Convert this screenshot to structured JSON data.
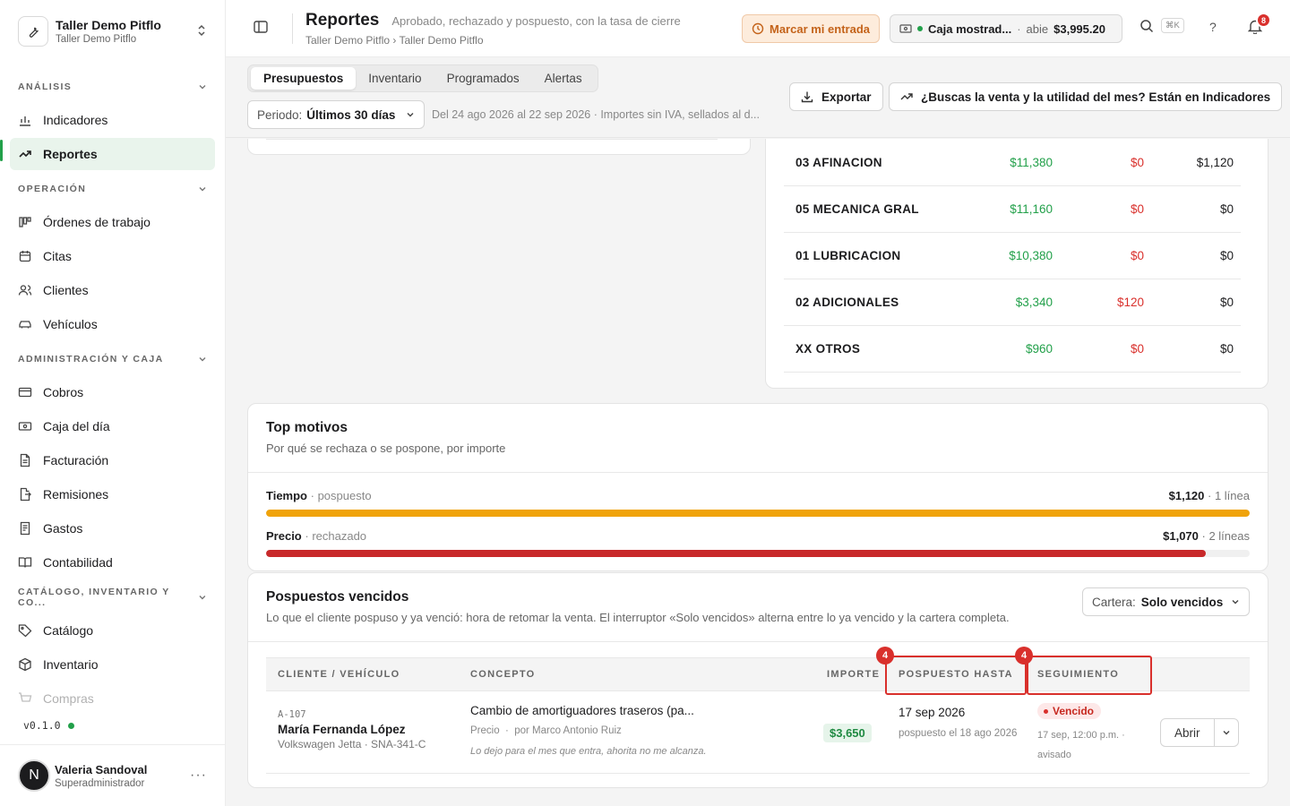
{
  "workspace": {
    "name": "Taller Demo Pitflo",
    "sub": "Taller Demo Pitflo"
  },
  "sidebar": {
    "sections": [
      {
        "label": "ANÁLISIS",
        "items": [
          "Indicadores",
          "Reportes"
        ]
      },
      {
        "label": "OPERACIÓN",
        "items": [
          "Órdenes de trabajo",
          "Citas",
          "Clientes",
          "Vehículos"
        ]
      },
      {
        "label": "ADMINISTRACIÓN Y CAJA",
        "items": [
          "Cobros",
          "Caja del día",
          "Facturación",
          "Remisiones",
          "Gastos",
          "Contabilidad"
        ]
      },
      {
        "label": "CATÁLOGO, INVENTARIO Y CO...",
        "items": [
          "Catálogo",
          "Inventario",
          "Compras"
        ]
      }
    ],
    "active_item": "Reportes",
    "version": "v0.1.0",
    "user": {
      "initial": "N",
      "name": "Valeria Sandoval",
      "role": "Superadministrador"
    }
  },
  "topbar": {
    "title": "Reportes",
    "description": "Aprobado, rechazado y pospuesto, con la tasa de cierre",
    "breadcrumb": "Taller Demo Pitflo › Taller Demo Pitflo",
    "entry_button": "Marcar mi entrada",
    "caja": {
      "name": "Caja mostrad...",
      "sep": "·",
      "status": "abie",
      "amount": "$3,995.20"
    },
    "search_shortcut": "⌘K",
    "help": "?",
    "notifications": "8"
  },
  "subbar": {
    "tabs": [
      "Presupuestos",
      "Inventario",
      "Programados",
      "Alertas"
    ],
    "active_tab": "Presupuestos",
    "period_label": "Periodo:",
    "period_value": "Últimos 30 días",
    "range_text": "Del 24 ago 2026 al 22 sep 2026 · Importes sin IVA, sellados al d...",
    "export_button": "Exportar",
    "indicators_button": "¿Buscas la venta y la utilidad del mes? Están en Indicadores"
  },
  "category_table": {
    "rows": [
      {
        "name": "03 AFINACION",
        "approved": "$11,380",
        "rejected": "$0",
        "postponed": "$1,120"
      },
      {
        "name": "05 MECANICA GRAL",
        "approved": "$11,160",
        "rejected": "$0",
        "postponed": "$0"
      },
      {
        "name": "01 LUBRICACION",
        "approved": "$10,380",
        "rejected": "$0",
        "postponed": "$0"
      },
      {
        "name": "02 ADICIONALES",
        "approved": "$3,340",
        "rejected": "$120",
        "postponed": "$0"
      },
      {
        "name": "XX OTROS",
        "approved": "$960",
        "rejected": "$0",
        "postponed": "$0"
      }
    ]
  },
  "top_motivos": {
    "title": "Top motivos",
    "subtitle": "Por qué se rechaza o se pospone, por importe",
    "items": [
      {
        "reason": "Tiempo",
        "type": "· pospuesto",
        "amount": "$1,120",
        "count": "· 1 línea",
        "fraction": 1.0,
        "color": "#f0a30a"
      },
      {
        "reason": "Precio",
        "type": "· rechazado",
        "amount": "$1,070",
        "count": "· 2 líneas",
        "fraction": 0.955,
        "color": "#c8292a"
      }
    ]
  },
  "pospuestos": {
    "title": "Pospuestos vencidos",
    "subtitle": "Lo que el cliente pospuso y ya venció: hora de retomar la venta. El interruptor «Solo vencidos» alterna entre lo ya vencido y la cartera completa.",
    "cartera_label": "Cartera:",
    "cartera_value": "Solo vencidos",
    "columns": {
      "client": "CLIENTE / VEHÍCULO",
      "concept": "CONCEPTO",
      "amount": "IMPORTE",
      "until": "POSPUESTO HASTA",
      "followup": "SEGUIMIENTO"
    },
    "highlight_badges": [
      "4",
      "4"
    ],
    "row": {
      "code": "A-107",
      "client": "María Fernanda López",
      "vehicle": "Volkswagen Jetta · SNA-341-C",
      "concept": "Cambio de amortiguadores traseros (pa...",
      "meta_reason": "Precio",
      "meta_sep": "·",
      "meta_by": "por Marco Antonio Ruiz",
      "quote": "Lo dejo para el mes que entra, ahorita no me alcanza.",
      "amount": "$3,650",
      "until_date": "17 sep 2026",
      "until_note": "pospuesto el 18 ago 2026",
      "status": "Vencido",
      "followup_note": "17 sep, 12:00 p.m. · avisado",
      "open_button": "Abrir"
    }
  }
}
